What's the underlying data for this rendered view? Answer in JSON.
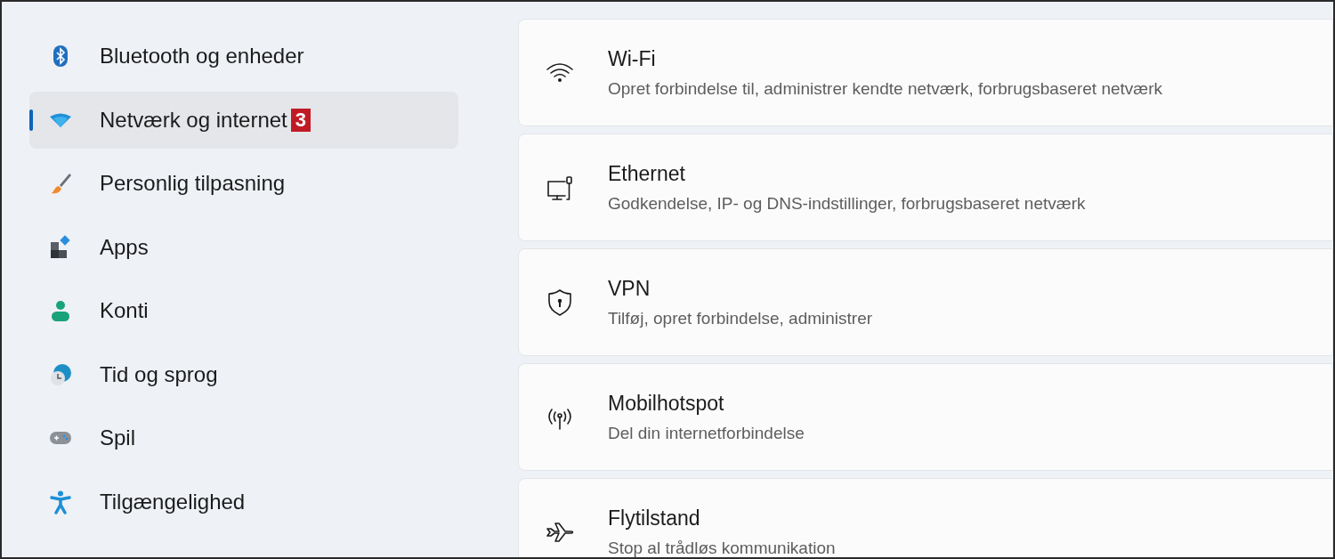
{
  "sidebar": {
    "items": [
      {
        "kind": "bluetooth",
        "label": "Bluetooth og enheder",
        "selected": false
      },
      {
        "kind": "network",
        "label": "Netværk og internet",
        "selected": true,
        "badge": "3"
      },
      {
        "kind": "brush",
        "label": "Personlig tilpasning",
        "selected": false
      },
      {
        "kind": "apps",
        "label": "Apps",
        "selected": false
      },
      {
        "kind": "account",
        "label": "Konti",
        "selected": false
      },
      {
        "kind": "time",
        "label": "Tid og sprog",
        "selected": false
      },
      {
        "kind": "gaming",
        "label": "Spil",
        "selected": false
      },
      {
        "kind": "accessibility",
        "label": "Tilgængelighed",
        "selected": false
      }
    ]
  },
  "settings": [
    {
      "kind": "wifi",
      "title": "Wi-Fi",
      "description": "Opret forbindelse til, administrer kendte netværk, forbrugsbaseret netværk"
    },
    {
      "kind": "ethernet",
      "title": "Ethernet",
      "description": "Godkendelse, IP- og DNS-indstillinger, forbrugsbaseret netværk"
    },
    {
      "kind": "vpn",
      "title": "VPN",
      "description": "Tilføj, opret forbindelse, administrer"
    },
    {
      "kind": "hotspot",
      "title": "Mobilhotspot",
      "description": "Del din internetforbindelse"
    },
    {
      "kind": "airplane",
      "title": "Flytilstand",
      "description": "Stop al trådløs kommunikation"
    }
  ]
}
